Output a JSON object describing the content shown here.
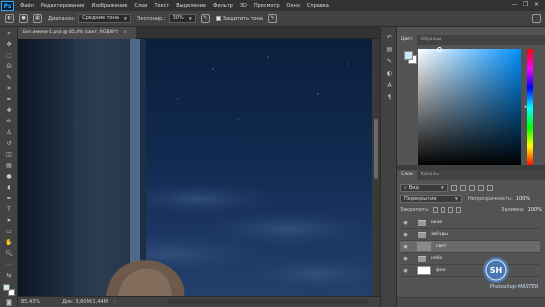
{
  "app": {
    "logo": "Ps"
  },
  "menu": [
    "Файл",
    "Редактирование",
    "Изображение",
    "Слои",
    "Текст",
    "Выделение",
    "Фильтр",
    "3D",
    "Просмотр",
    "Окно",
    "Справка"
  ],
  "window_controls": {
    "minimize": "—",
    "restore": "❐",
    "close": "✕"
  },
  "options": {
    "range_label": "Диапазон:",
    "range_value": "Средние тона",
    "exposure_label": "Экспонир.:",
    "exposure_value": "30%",
    "protect_tones_label": "Защитить тона",
    "protect_tones_checked": true
  },
  "document": {
    "tab_title": "Без имени-1.psd @ 85,4% (свет, RGB/8*)",
    "tab_close": "×"
  },
  "status": {
    "zoom": "85,43%",
    "doc_info": "Док: 3,60M/1,44M",
    "arrow": "›"
  },
  "color_panel": {
    "tabs": [
      "Цвет",
      "Образцы"
    ],
    "active_tab": 0,
    "fg_color": "#d0e6f5",
    "bg_color": "#ffffff"
  },
  "layers_panel": {
    "tabs": [
      "Слои",
      "Каналы"
    ],
    "active_tab": 0,
    "filter_kind": "Вид",
    "blend_mode": "Перекрытие",
    "opacity_label": "Непрозрачность:",
    "opacity_value": "100%",
    "lock_label": "Закрепить:",
    "fill_label": "Заливка:",
    "fill_value": "100%",
    "layers": [
      {
        "name": "окно",
        "kind": "folder",
        "selected": false
      },
      {
        "name": "звёзды",
        "kind": "folder",
        "selected": false
      },
      {
        "name": "свет",
        "kind": "layer",
        "selected": true
      },
      {
        "name": "небо",
        "kind": "folder",
        "selected": false
      },
      {
        "name": "фон",
        "kind": "layer",
        "selected": false
      }
    ]
  },
  "watermark": {
    "badge": "SH",
    "caption": "Photoshop-MASTER"
  }
}
